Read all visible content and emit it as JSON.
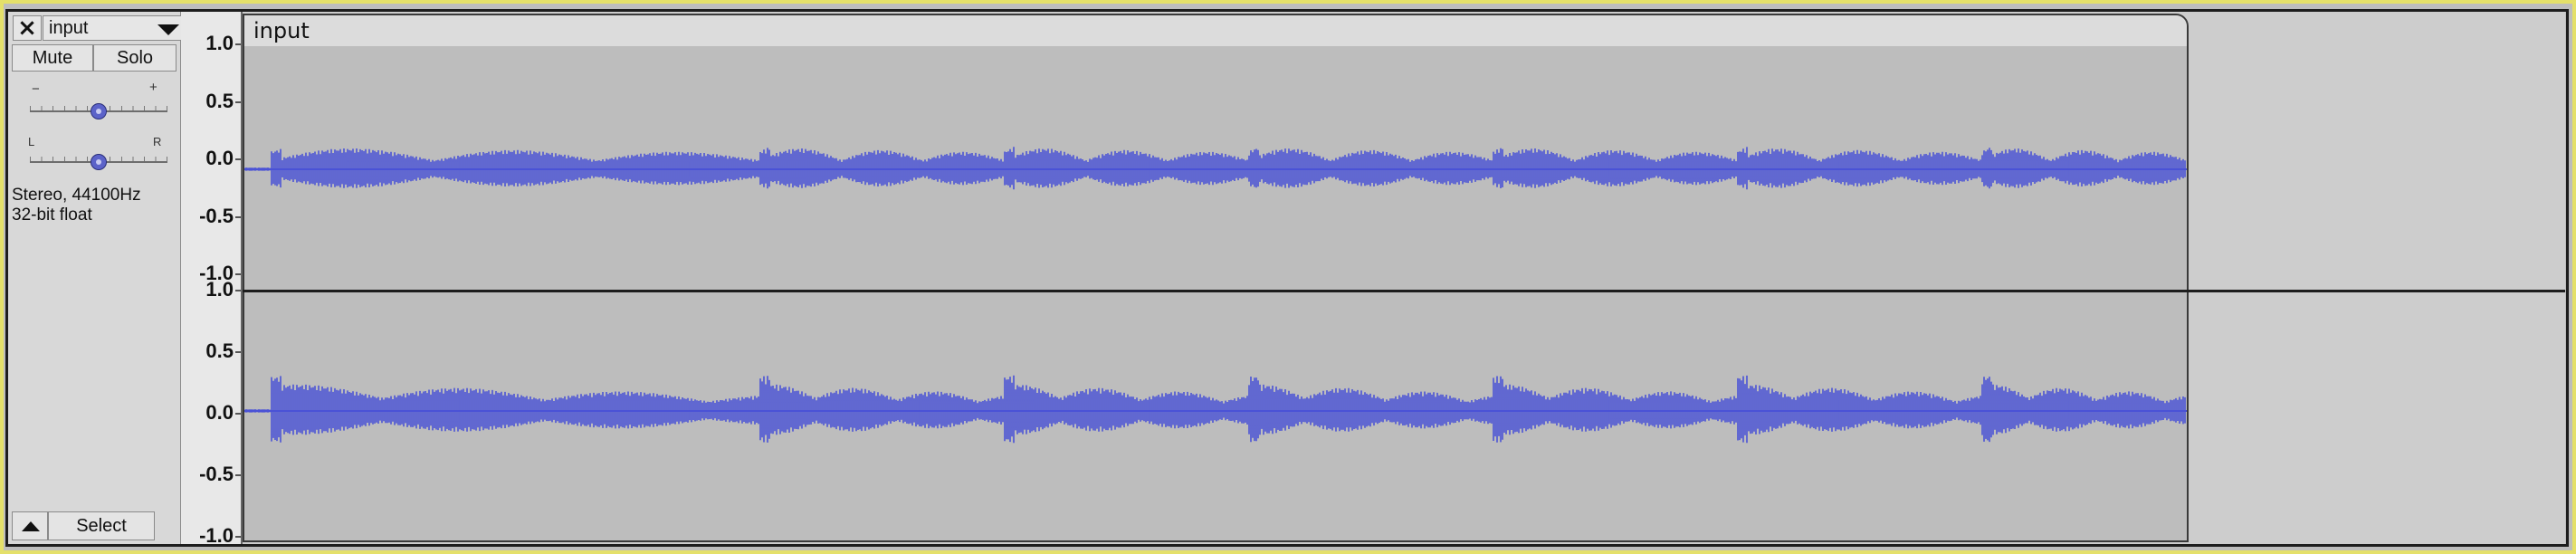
{
  "track": {
    "close_glyph": "×",
    "name": "input",
    "mute_label": "Mute",
    "solo_label": "Solo",
    "gain_minus": "−",
    "gain_plus": "+",
    "pan_left": "L",
    "pan_right": "R",
    "gain_level": 0.5,
    "pan_level": 0.5,
    "info_line1": "Stereo, 44100Hz",
    "info_line2": "32-bit float",
    "select_label": "Select",
    "collapse_icon": "triangle-up-icon"
  },
  "clip": {
    "name": "input"
  },
  "ruler": {
    "channel_labels": [
      "1.0",
      "0.5",
      "0.0",
      "-0.5",
      "-1.0"
    ]
  },
  "colors": {
    "waveform": "#4a52d6",
    "background": "#bdbdbd",
    "border": "#e4e06a"
  }
}
